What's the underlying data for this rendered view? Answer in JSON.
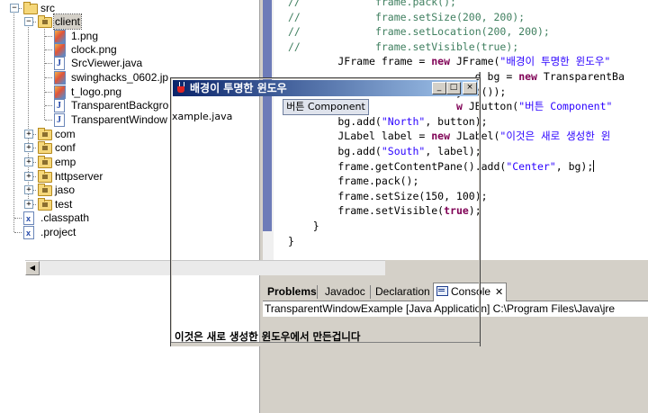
{
  "tree": {
    "items": [
      {
        "label": "src",
        "kind": "folder"
      },
      {
        "label": "client",
        "kind": "package"
      },
      {
        "label": "1.png",
        "kind": "image"
      },
      {
        "label": "clock.png",
        "kind": "image"
      },
      {
        "label": "SrcViewer.java",
        "kind": "java"
      },
      {
        "label": "swinghacks_0602.jp",
        "kind": "image"
      },
      {
        "label": "t_logo.png",
        "kind": "image"
      },
      {
        "label": "TransparentBackgro",
        "kind": "java"
      },
      {
        "label": "TransparentWindow",
        "kind": "java"
      },
      {
        "label": "com",
        "kind": "package"
      },
      {
        "label": "conf",
        "kind": "package"
      },
      {
        "label": "emp",
        "kind": "package"
      },
      {
        "label": "httpserver",
        "kind": "package"
      },
      {
        "label": "jaso",
        "kind": "package"
      },
      {
        "label": "test",
        "kind": "package"
      },
      {
        "label": ".classpath",
        "kind": "xml"
      },
      {
        "label": ".project",
        "kind": "xml"
      }
    ],
    "expand_plus": "+",
    "expand_minus": "−"
  },
  "editor": {
    "lines": [
      [
        {
          "t": "//",
          "c": "cm"
        },
        {
          "t": "            frame.pack();",
          "c": "cm"
        }
      ],
      [
        {
          "t": "//",
          "c": "cm"
        },
        {
          "t": "            frame.setSize(200, 200);",
          "c": "cm"
        }
      ],
      [
        {
          "t": "//",
          "c": "cm"
        },
        {
          "t": "            frame.setLocation(200, 200);",
          "c": "cm"
        }
      ],
      [
        {
          "t": "//",
          "c": "cm"
        },
        {
          "t": "            frame.setVisible(true);",
          "c": "cm"
        }
      ],
      [
        {
          "t": "        JFrame frame = ",
          "c": ""
        },
        {
          "t": "new",
          "c": "kw"
        },
        {
          "t": " JFrame(",
          "c": ""
        },
        {
          "t": "\"배경이 투명한 윈도우\"",
          "c": "st"
        }
      ],
      [
        {
          "t": "        ",
          "c": ""
        },
        {
          "t": "         ",
          "c": ""
        },
        {
          "t": "             d bg = ",
          "c": ""
        },
        {
          "t": "new",
          "c": "kw"
        },
        {
          "t": " TransparentBa",
          "c": ""
        }
      ],
      [
        {
          "t": "        ",
          "c": ""
        },
        {
          "t": "             rderLayout());",
          "c": ""
        }
      ],
      [
        {
          "t": "        ",
          "c": ""
        },
        {
          "t": "             ",
          "c": ""
        },
        {
          "t": "      ",
          "c": ""
        },
        {
          "t": "w",
          "c": "kw"
        },
        {
          "t": " JButton(",
          "c": ""
        },
        {
          "t": "\"버튼 Component\"",
          "c": "st"
        }
      ],
      [
        {
          "t": "        bg.add(",
          "c": ""
        },
        {
          "t": "\"North\"",
          "c": "st"
        },
        {
          "t": ", button);",
          "c": ""
        }
      ],
      [
        {
          "t": "        JLabel label = ",
          "c": ""
        },
        {
          "t": "new",
          "c": "kw"
        },
        {
          "t": " JLabel(",
          "c": ""
        },
        {
          "t": "\"이것은 새로 생성한 윈",
          "c": "st"
        }
      ],
      [
        {
          "t": "        bg.add(",
          "c": ""
        },
        {
          "t": "\"South\"",
          "c": "st"
        },
        {
          "t": ", label);",
          "c": ""
        }
      ],
      [
        {
          "t": "        frame.getContentPane().add(",
          "c": ""
        },
        {
          "t": "\"Center\"",
          "c": "st"
        },
        {
          "t": ", bg);",
          "c": ""
        },
        {
          "t": "|",
          "c": "cursor"
        }
      ],
      [
        {
          "t": "        frame.pack();",
          "c": ""
        }
      ],
      [
        {
          "t": "        frame.setSize(150, 100);",
          "c": ""
        }
      ],
      [
        {
          "t": "        frame.setVisible(",
          "c": ""
        },
        {
          "t": "true",
          "c": "kw"
        },
        {
          "t": ");",
          "c": ""
        }
      ],
      [
        {
          "t": "    }",
          "c": ""
        }
      ],
      [
        {
          "t": "}",
          "c": ""
        }
      ]
    ],
    "scroll_left_arrow": "◀"
  },
  "console": {
    "tabs": [
      {
        "label": "Problems",
        "active": false
      },
      {
        "label": "Javadoc",
        "active": false
      },
      {
        "label": "Declaration",
        "active": false
      },
      {
        "label": "Console",
        "active": true
      }
    ],
    "close_glyph": "✕",
    "launch_label": "TransparentWindowExample [Java Application] C:\\Program Files\\Java\\jre"
  },
  "jframe": {
    "title": "배경이 투명한 윈도우",
    "button_label": "버튼 Component",
    "label_text": "이것은 새로 생성한 윈도우에서 만든겁니다",
    "background_text": "xample.java",
    "minimize_glyph": "_",
    "maximize_glyph": "□",
    "close_glyph": "×"
  },
  "colors": {
    "comment": "#3f7f5f",
    "keyword": "#7f0055",
    "string": "#2a00ff",
    "title_bar_start": "#0a246a",
    "title_bar_end": "#a6caf0",
    "chrome": "#d4d0c8"
  }
}
